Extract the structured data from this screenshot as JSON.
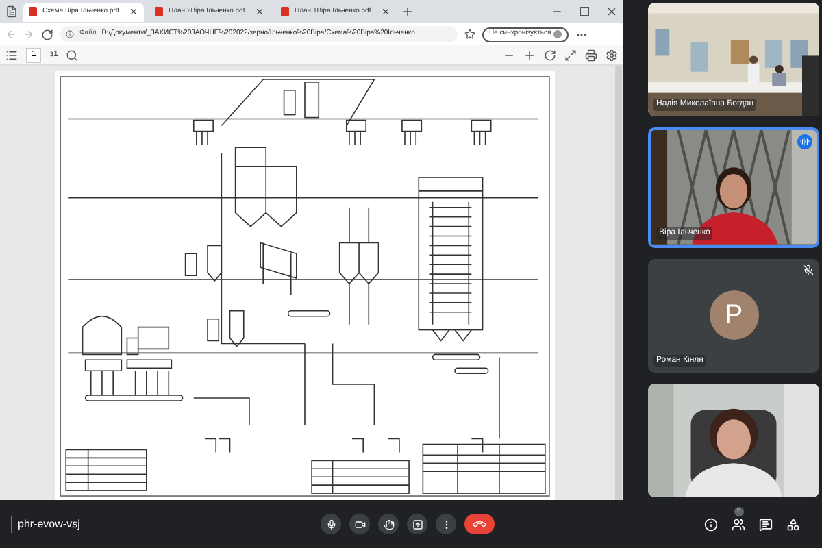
{
  "browser": {
    "tabs": [
      {
        "title": "Схема Віра Ільченко.pdf",
        "selected": true
      },
      {
        "title": "План 2Віра Ільченко.pdf",
        "selected": false
      },
      {
        "title": "План 1Віра Ільченко.pdf",
        "selected": false
      }
    ],
    "address": {
      "scheme": "Файл",
      "url": "D:/Документи/_ЗАХИСТ%203АОЧНЕ%202022/зерно/Ільченко%20Віра/Схема%20Віра%20Ільченко..."
    },
    "sync_button": "Не синхронізується",
    "pdf_toolbar": {
      "page": "1",
      "page_count": "з1"
    }
  },
  "participants": [
    {
      "kind": "video",
      "name": "Надія Миколаївна Богдан",
      "speaking": false,
      "muted": false
    },
    {
      "kind": "video",
      "name": "Віра Ільченко",
      "speaking": true,
      "muted": false
    },
    {
      "kind": "avatar",
      "name": "Роман Кінля",
      "initial": "Р",
      "color": "#a0826d",
      "speaking": false,
      "muted": true
    },
    {
      "kind": "video",
      "speaking": false,
      "muted": false
    }
  ],
  "meeting_code": "phr-evow-vsj",
  "people_count": "5"
}
